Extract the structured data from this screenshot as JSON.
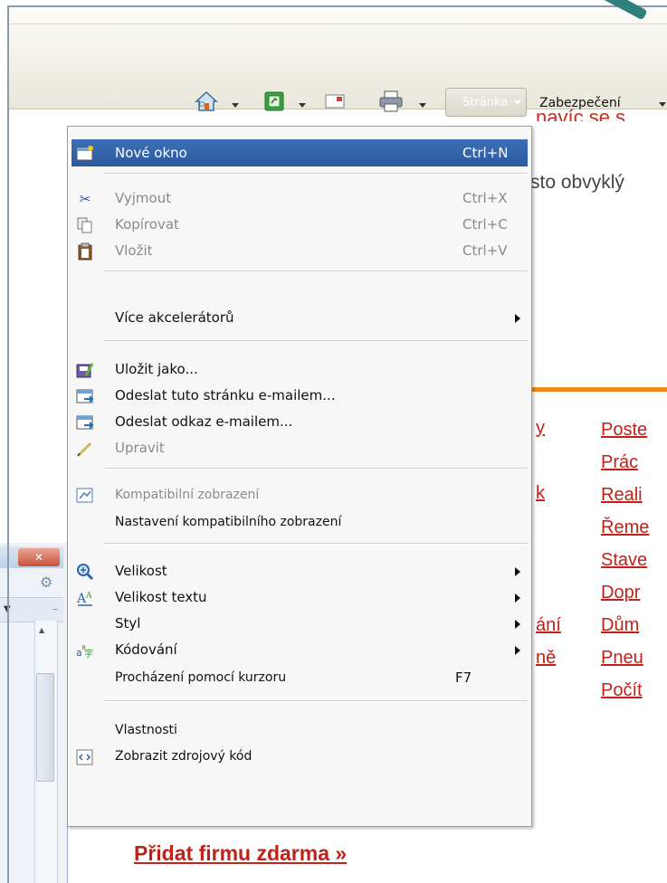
{
  "toolbar": {
    "page_label": "Stránka",
    "security_label": "Zabezpečení"
  },
  "content": {
    "red_heading_fragment": "navíc se s",
    "text_fragment": "sto obvyklý",
    "links_right": [
      "Poste",
      "Prác",
      "Reali",
      "Řeme",
      "Stave",
      "Dopr",
      "Dům",
      "Pneu",
      "Počít"
    ],
    "links_left": [
      "y",
      "k",
      "ání",
      "ně"
    ],
    "add_company": "Přidat firmu zdarma »"
  },
  "menu": {
    "items": [
      {
        "label": "Nové okno",
        "shortcut": "Ctrl+N",
        "icon": "new-window-icon",
        "state": "active"
      },
      {
        "label": "Vyjmout",
        "shortcut": "Ctrl+X",
        "icon": "cut-icon",
        "state": "disabled"
      },
      {
        "label": "Kopírovat",
        "shortcut": "Ctrl+C",
        "icon": "copy-icon",
        "state": "disabled"
      },
      {
        "label": "Vložit",
        "shortcut": "Ctrl+V",
        "icon": "paste-icon",
        "state": "disabled"
      },
      {
        "label": "Více akcelerátorů",
        "shortcut": "",
        "icon": "",
        "state": "submenu"
      },
      {
        "label": "Uložit jako...",
        "shortcut": "",
        "icon": "save-as-icon",
        "state": "normal"
      },
      {
        "label": "Odeslat tuto stránku e-mailem...",
        "shortcut": "",
        "icon": "email-page-icon",
        "state": "normal"
      },
      {
        "label": "Odeslat odkaz e-mailem...",
        "shortcut": "",
        "icon": "email-link-icon",
        "state": "normal"
      },
      {
        "label": "Upravit",
        "shortcut": "",
        "icon": "edit-pencil-icon",
        "state": "disabled"
      },
      {
        "label": "Kompatibilní zobrazení",
        "shortcut": "",
        "icon": "compatibility-view-icon",
        "state": "disabled"
      },
      {
        "label": "Nastavení kompatibilního zobrazení",
        "shortcut": "",
        "icon": "",
        "state": "normal"
      },
      {
        "label": "Velikost",
        "shortcut": "",
        "icon": "zoom-icon",
        "state": "submenu"
      },
      {
        "label": "Velikost textu",
        "shortcut": "",
        "icon": "text-size-icon",
        "state": "submenu"
      },
      {
        "label": "Styl",
        "shortcut": "",
        "icon": "",
        "state": "submenu"
      },
      {
        "label": "Kódování",
        "shortcut": "",
        "icon": "encoding-icon",
        "state": "submenu"
      },
      {
        "label": "Procházení pomocí kurzoru",
        "shortcut": "F7",
        "icon": "",
        "state": "normal"
      },
      {
        "label": "Vlastnosti",
        "shortcut": "",
        "icon": "",
        "state": "normal"
      },
      {
        "label": "Zobrazit zdrojový kód",
        "shortcut": "",
        "icon": "view-source-icon",
        "state": "normal"
      }
    ]
  },
  "colors": {
    "link_red": "#c0221a",
    "menu_highlight": "#2b5aa0",
    "orange_rule": "#f08a1c"
  }
}
